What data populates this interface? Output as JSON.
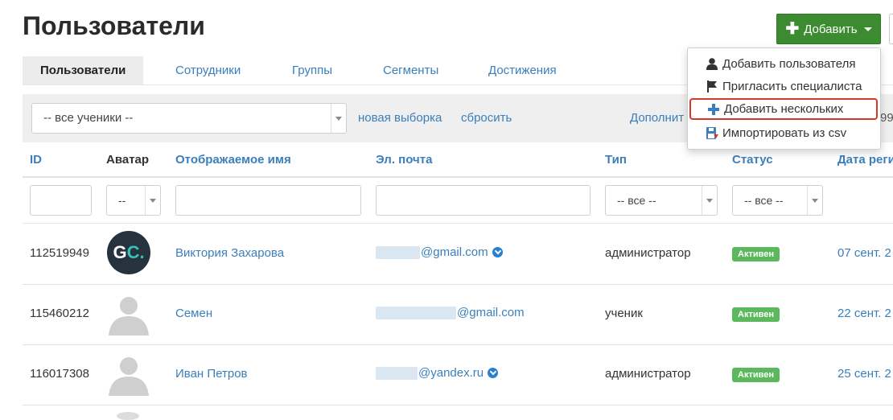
{
  "page": {
    "title": "Пользователи"
  },
  "header": {
    "add_button_label": "Добавить"
  },
  "tabs": [
    {
      "label": "Пользователи",
      "active": true
    },
    {
      "label": "Сотрудники"
    },
    {
      "label": "Группы"
    },
    {
      "label": "Сегменты"
    },
    {
      "label": "Достижения"
    }
  ],
  "filterbar": {
    "segment_select": "-- все ученики --",
    "new_selection_link": "новая выборка",
    "reset_link": "сбросить",
    "more_link_partial": "Дополнит",
    "count_partial": "99"
  },
  "table": {
    "headers": {
      "id": "ID",
      "avatar": "Аватар",
      "name": "Отображаемое имя",
      "email": "Эл. почта",
      "type": "Тип",
      "status": "Статус",
      "date": "Дата реги"
    },
    "filters": {
      "avatar_select": "--",
      "type_select": "-- все --",
      "status_select": "-- все --"
    },
    "rows": [
      {
        "id": "112519949",
        "name": "Виктория Захарова",
        "email_visible": "@gmail.com",
        "type": "администратор",
        "status": "Активен",
        "date": "07 сент. 2",
        "avatar": "gc-logo"
      },
      {
        "id": "115460212",
        "name": "Семен",
        "email_visible": "@gmail.com",
        "type": "ученик",
        "status": "Активен",
        "date": "22 сент. 2",
        "avatar": "default-user"
      },
      {
        "id": "116017308",
        "name": "Иван Петров",
        "email_visible": "@yandex.ru",
        "type": "администратор",
        "status": "Активен",
        "date": "25 сент. 2",
        "avatar": "default-user"
      }
    ]
  },
  "dropdown": {
    "items": [
      {
        "label": "Добавить пользователя",
        "icon": "user-icon"
      },
      {
        "label": "Пригласить специалиста",
        "icon": "flag-icon"
      },
      {
        "label": "Добавить нескольких",
        "icon": "plus-icon",
        "highlighted": true
      },
      {
        "label": "Импортировать из csv",
        "icon": "import-icon"
      }
    ]
  },
  "colors": {
    "brand_green": "#3c8b30",
    "link_blue": "#3a7fbc",
    "badge_green": "#5cb85c",
    "highlight_red": "#d9372c"
  }
}
